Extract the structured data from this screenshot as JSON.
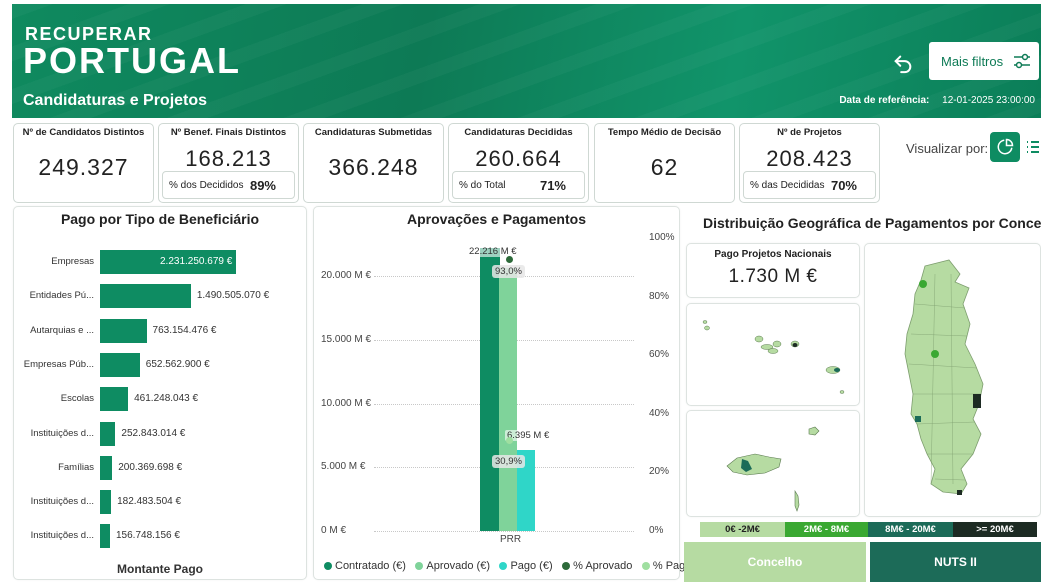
{
  "header": {
    "logo_top": "RECUPERAR",
    "logo_bottom": "PORTUGAL",
    "subtitle": "Candidaturas e Projetos",
    "ref_label": "Data de referência:",
    "ref_value": "12-01-2025 23:00:00",
    "filters_label": "Mais filtros"
  },
  "kpis": {
    "candidatos": {
      "title": "Nº de Candidatos Distintos",
      "value": "249.327"
    },
    "benef": {
      "title": "Nº Benef. Finais Distintos",
      "value": "168.213",
      "sub_label": "% dos Decididos",
      "sub_value": "89%"
    },
    "submetidas": {
      "title": "Candidaturas Submetidas",
      "value": "366.248"
    },
    "decididas": {
      "title": "Candidaturas Decididas",
      "value": "260.664",
      "sub_label": "% do Total",
      "sub_value": "71%"
    },
    "tempo": {
      "title": "Tempo Médio de Decisão",
      "value": "62"
    },
    "projetos": {
      "title": "Nº de Projetos",
      "value": "208.423",
      "sub_label": "% das Decididas",
      "sub_value": "70%"
    }
  },
  "visualizar": {
    "label": "Visualizar por:"
  },
  "beneficiario": {
    "title": "Pago por Tipo de Beneficiário",
    "xlabel": "Montante Pago"
  },
  "aprovacoes": {
    "title": "Aprovações e Pagamentos",
    "y_ticks": [
      "20.000 M €",
      "15.000 M €",
      "10.000 M €",
      "5.000 M €",
      "0 M €"
    ],
    "y2_ticks": [
      "100%",
      "80%",
      "60%",
      "40%",
      "20%",
      "0%"
    ],
    "category": "PRR",
    "label_contratado": "22.216 M €",
    "label_aprovado_pct": "93,0%",
    "label_pago": "6.395 M €",
    "label_pago_pct": "30,9%",
    "legend": [
      "Contratado (€)",
      "Aprovado (€)",
      "Pago (€)",
      "% Aprovado",
      "% Pago"
    ]
  },
  "geo": {
    "title": "Distribuição Geográfica de Pagamentos por Concelho",
    "nacional_label": "Pago Projetos Nacionais",
    "nacional_value": "1.730 M €",
    "legend": [
      "0€ -2M€",
      "2M€ - 8M€",
      "8M€ - 20M€",
      ">= 20M€"
    ],
    "legend_colors": [
      "#b6dba2",
      "#3aa832",
      "#1c6b58",
      "#1d2b23"
    ],
    "tab_concelho": "Concelho",
    "tab_nuts": "NUTS II"
  },
  "colors": {
    "contratado": "#0e8c62",
    "aprovado": "#7fd39a",
    "pago": "#2fd6c8",
    "pct_aprovado": "#2d6a3a",
    "pct_pago": "#9fdfa0"
  },
  "chart_data": [
    {
      "type": "bar",
      "title": "Pago por Tipo de Beneficiário",
      "xlabel": "Montante Pago",
      "categories": [
        "Empresas",
        "Entidades Pú...",
        "Autarquias e ...",
        "Empresas Púb...",
        "Escolas",
        "Instituições d...",
        "Famílias",
        "Instituições d...",
        "Instituições d..."
      ],
      "values": [
        2231250679,
        1490505070,
        763154476,
        652562900,
        461248043,
        252843014,
        200369698,
        182483504,
        156748156
      ],
      "labels": [
        "2.231.250.679 €",
        "1.490.505.070 €",
        "763.154.476 €",
        "652.562.900 €",
        "461.248.043 €",
        "252.843.014 €",
        "200.369.698 €",
        "182.483.504 €",
        "156.748.156 €"
      ]
    },
    {
      "type": "bar",
      "title": "Aprovações e Pagamentos",
      "categories": [
        "PRR"
      ],
      "ylim": [
        0,
        23000
      ],
      "y2lim": [
        0,
        100
      ],
      "series": [
        {
          "name": "Contratado (€)",
          "values": [
            22216
          ]
        },
        {
          "name": "Aprovado (€)",
          "values": [
            20660
          ]
        },
        {
          "name": "Pago (€)",
          "values": [
            6395
          ]
        },
        {
          "name": "% Aprovado",
          "values": [
            93.0
          ]
        },
        {
          "name": "% Pago",
          "values": [
            30.9
          ]
        }
      ]
    }
  ]
}
